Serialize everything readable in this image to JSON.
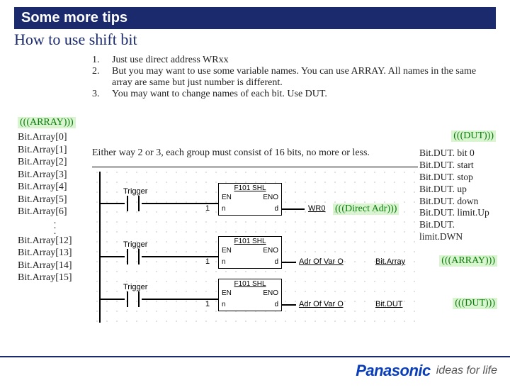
{
  "header": {
    "title": "Some more tips",
    "subtitle": "How to use shift bit"
  },
  "tips": {
    "n1": "1.",
    "t1": "Just use direct address WRxx",
    "n2": "2.",
    "t2": "But you may want to use some variable names.  You can use ARRAY.  All names in the same array are same but just number is different.",
    "n3": "3.",
    "t3": "You may want to change names of each bit.  Use DUT."
  },
  "either_way": "Either way 2 or 3, each group must consist of 16 bits, no more or less.",
  "tags": {
    "array": "(((ARRAY)))",
    "dut": "(((DUT)))",
    "direct": "(((Direct Adr)))"
  },
  "left_array": {
    "a0": "Bit.Array[0]",
    "a1": "Bit.Array[1]",
    "a2": "Bit.Array[2]",
    "a3": "Bit.Array[3]",
    "a4": "Bit.Array[4]",
    "a5": "Bit.Array[5]",
    "a6": "Bit.Array[6]",
    "a12": "Bit.Array[12]",
    "a13": "Bit.Array[13]",
    "a14": "Bit.Array[14]",
    "a15": "Bit.Array[15]"
  },
  "right_dut": {
    "d0": "Bit.DUT. bit 0",
    "d1": "Bit.DUT. start",
    "d2": "Bit.DUT. stop",
    "d3": "Bit.DUT. up",
    "d4": "Bit.DUT. down",
    "d5": "Bit.DUT. limit.Up",
    "d6": "Bit.DUT. limit.DWN"
  },
  "ladder": {
    "trigger": "Trigger",
    "fblock": "F101  SHL",
    "en": "EN",
    "eno": "ENO",
    "n": "n",
    "d": "d",
    "one": "1",
    "wr0": "WR0",
    "adr_of_var": "Adr Of Var O",
    "bit_array": "Bit.Array",
    "bit_dut": "Bit.DUT"
  },
  "footer": {
    "brand": "Panasonic",
    "slogan": "ideas for life"
  }
}
